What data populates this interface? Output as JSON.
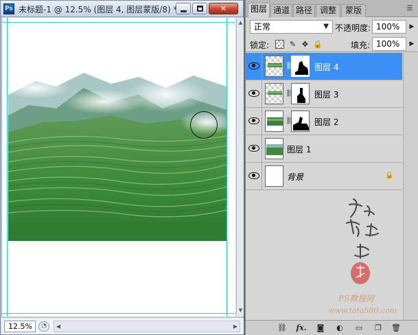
{
  "document": {
    "app_icon": "Ps",
    "title": "未标题-1 @ 12.5% (图层 4, 图层蒙版/8) *",
    "zoom": "12.5%",
    "controls": [
      "minimize-icon",
      "maximize-icon",
      "close-icon"
    ]
  },
  "panel": {
    "tabs": [
      "图层",
      "通道",
      "路径",
      "调整",
      "蒙版"
    ],
    "active_tab": "图层",
    "blend_mode": "正常",
    "opacity_label": "不透明度:",
    "opacity": "100%",
    "lock_label": "锁定:",
    "fill_label": "填充:",
    "fill": "100%",
    "layers": [
      {
        "name": "图层 4",
        "selected": true,
        "has_mask": true,
        "visible": true
      },
      {
        "name": "图层 3",
        "selected": false,
        "has_mask": true,
        "visible": true
      },
      {
        "name": "图层 2",
        "selected": false,
        "has_mask": true,
        "visible": true
      },
      {
        "name": "图层 1",
        "selected": false,
        "has_mask": false,
        "visible": true
      },
      {
        "name": "背景",
        "selected": false,
        "has_mask": false,
        "visible": true,
        "locked": true
      }
    ],
    "footer_buttons": [
      "link-icon",
      "fx-icon",
      "add-mask-icon",
      "adjustment-icon",
      "folder-icon",
      "new-layer-icon",
      "trash-icon"
    ],
    "fx_label": "fx."
  },
  "watermark": {
    "calligraphy": "他她我帮你",
    "site_name": "PS教程网",
    "url": "www.tata580.com"
  },
  "colors": {
    "selection": "#3b8ff5",
    "guides": "#19d3d3",
    "close_button": "#c2452d"
  }
}
